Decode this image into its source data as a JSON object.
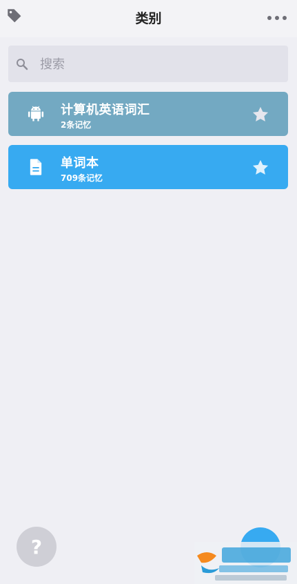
{
  "header": {
    "title": "类别",
    "left_icon": "tag-icon",
    "right_icon": "more-icon"
  },
  "search": {
    "placeholder": "搜索",
    "icon": "search-icon"
  },
  "categories": [
    {
      "title": "计算机英语词汇",
      "count": "2条记忆",
      "icon": "android-icon",
      "color": "#73a9c2"
    },
    {
      "title": "单词本",
      "count": "709条记忆",
      "icon": "document-icon",
      "color": "#37aaf1"
    }
  ],
  "help": {
    "label": "?"
  },
  "colors": {
    "accent": "#37aaf1",
    "muted_card": "#73a9c2",
    "background": "#efeff4"
  }
}
